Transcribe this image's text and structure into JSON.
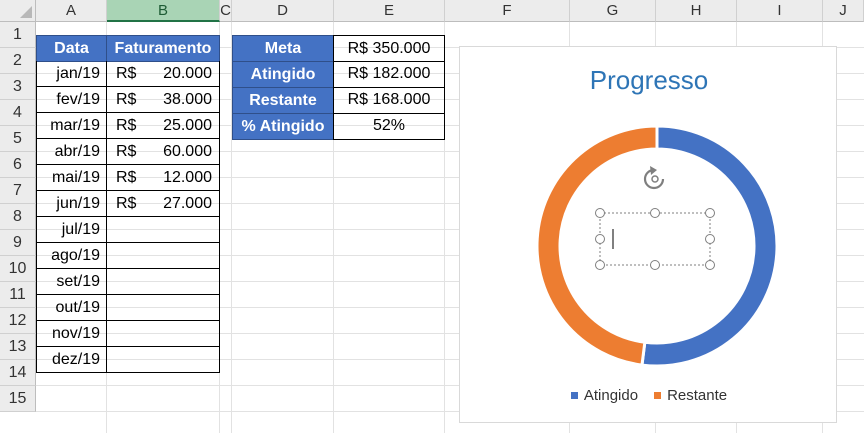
{
  "columns": [
    "A",
    "B",
    "C",
    "D",
    "E",
    "F",
    "G",
    "H",
    "I",
    "J"
  ],
  "rows": [
    "1",
    "2",
    "3",
    "4",
    "5",
    "6",
    "7",
    "8",
    "9",
    "10",
    "11",
    "12",
    "13",
    "14",
    "15"
  ],
  "table1": {
    "headers": {
      "date": "Data",
      "revenue": "Faturamento"
    },
    "rows": [
      {
        "month": "jan/19",
        "currency": "R$",
        "value": "20.000"
      },
      {
        "month": "fev/19",
        "currency": "R$",
        "value": "38.000"
      },
      {
        "month": "mar/19",
        "currency": "R$",
        "value": "25.000"
      },
      {
        "month": "abr/19",
        "currency": "R$",
        "value": "60.000"
      },
      {
        "month": "mai/19",
        "currency": "R$",
        "value": "12.000"
      },
      {
        "month": "jun/19",
        "currency": "R$",
        "value": "27.000"
      },
      {
        "month": "jul/19",
        "currency": "",
        "value": ""
      },
      {
        "month": "ago/19",
        "currency": "",
        "value": ""
      },
      {
        "month": "set/19",
        "currency": "",
        "value": ""
      },
      {
        "month": "out/19",
        "currency": "",
        "value": ""
      },
      {
        "month": "nov/19",
        "currency": "",
        "value": ""
      },
      {
        "month": "dez/19",
        "currency": "",
        "value": ""
      }
    ]
  },
  "table2": {
    "rows": [
      {
        "label": "Meta",
        "value": "R$  350.000"
      },
      {
        "label": "Atingido",
        "value": "R$  182.000"
      },
      {
        "label": "Restante",
        "value": "R$  168.000"
      },
      {
        "label": "% Atingido",
        "value": "52%"
      }
    ]
  },
  "colors": {
    "blue": "#4472c4",
    "orange": "#ed7d31",
    "selected_col": "#a9d4b5"
  },
  "chart_data": {
    "type": "pie",
    "subtype": "doughnut",
    "title": "Progresso",
    "categories": [
      "Atingido",
      "Restante"
    ],
    "values": [
      182000,
      168000
    ],
    "colors": [
      "#4472c4",
      "#ed7d31"
    ],
    "legend": "bottom"
  }
}
